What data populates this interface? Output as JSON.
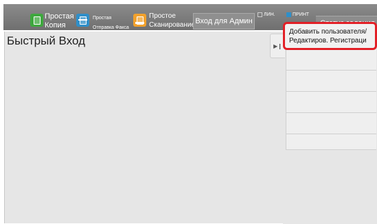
{
  "topbar": {
    "copy_label_line1": "Простая",
    "copy_label_line2": "Копия",
    "fax_label_line1": "Простая",
    "fax_label_line2": "Отправка Факса",
    "scan_label_line1": "Простое",
    "scan_label_line2": "Сканирование",
    "admin_button": "Вход для Админ",
    "line_indicator": "ЛИН.",
    "print_indicator": "ПРИНТ",
    "status_button": "Статус задания"
  },
  "main": {
    "title": "Быстрый Вход"
  },
  "menu": {
    "add_user_line1": "Добавить пользователя/",
    "add_user_line2": "Редактиров. Регистраци"
  },
  "colors": {
    "copy_icon": "#3ea83e",
    "fax_icon": "#2f8fc9",
    "scan_icon": "#f1a12d",
    "highlight_border": "#e21f26",
    "topbar": "#7a7a7a"
  }
}
